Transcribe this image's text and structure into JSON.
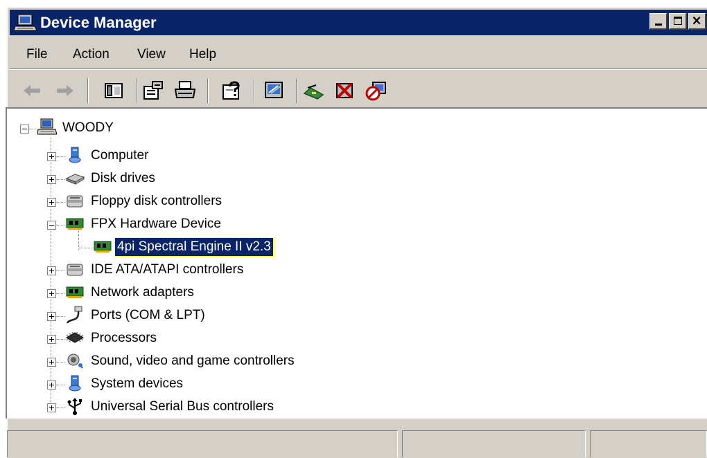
{
  "window": {
    "title": "Device Manager"
  },
  "colors": {
    "titlebar": "#0a246a",
    "chrome": "#d4d0c8",
    "selection": "#0a246a"
  },
  "caption_buttons": [
    {
      "name": "minimize-button",
      "icon": "minimize-icon"
    },
    {
      "name": "maximize-button",
      "icon": "maximize-icon"
    },
    {
      "name": "close-button",
      "icon": "close-icon"
    }
  ],
  "menu": [
    "File",
    "Action",
    "View",
    "Help"
  ],
  "toolbar": [
    {
      "name": "back-button",
      "icon": "back-arrow-icon"
    },
    {
      "name": "forward-button",
      "icon": "forward-arrow-icon"
    },
    {
      "name": "show-hide-console-tree-button",
      "icon": "console-tree-icon"
    },
    {
      "name": "properties-button",
      "icon": "properties-icon"
    },
    {
      "name": "print-button",
      "icon": "printer-icon"
    },
    {
      "name": "help-button",
      "icon": "help-icon"
    },
    {
      "name": "scan-hardware-button",
      "icon": "scan-hardware-icon"
    },
    {
      "name": "update-driver-button",
      "icon": "update-driver-icon"
    },
    {
      "name": "uninstall-button",
      "icon": "uninstall-icon"
    },
    {
      "name": "disable-button",
      "icon": "disable-icon"
    }
  ],
  "tree": {
    "root": {
      "label": "WOODY",
      "icon": "computer-icon",
      "expanded": true
    },
    "items": [
      {
        "label": "Computer",
        "icon": "computer-category-icon",
        "expanded": false
      },
      {
        "label": "Disk drives",
        "icon": "disk-drive-icon",
        "expanded": false
      },
      {
        "label": "Floppy disk controllers",
        "icon": "floppy-controller-icon",
        "expanded": false
      },
      {
        "label": "FPX Hardware Device",
        "icon": "circuit-board-icon",
        "expanded": true,
        "children": [
          {
            "label": "4pi Spectral Engine II v2.3",
            "icon": "circuit-board-icon",
            "selected": true
          }
        ]
      },
      {
        "label": "IDE ATA/ATAPI controllers",
        "icon": "ide-controller-icon",
        "expanded": false
      },
      {
        "label": "Network adapters",
        "icon": "network-adapter-icon",
        "expanded": false
      },
      {
        "label": "Ports (COM & LPT)",
        "icon": "port-icon",
        "expanded": false
      },
      {
        "label": "Processors",
        "icon": "processor-icon",
        "expanded": false
      },
      {
        "label": "Sound, video and game controllers",
        "icon": "speaker-icon",
        "expanded": false
      },
      {
        "label": "System devices",
        "icon": "system-devices-icon",
        "expanded": false
      },
      {
        "label": "Universal Serial Bus controllers",
        "icon": "usb-icon",
        "expanded": false
      }
    ]
  }
}
